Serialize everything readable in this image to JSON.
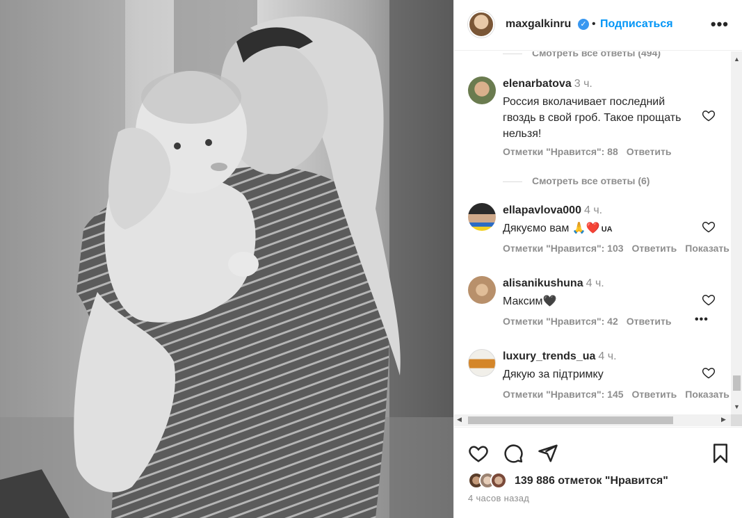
{
  "header": {
    "username": "maxgalkinru",
    "verified_icon": "verified-badge-icon",
    "separator": "•",
    "follow_label": "Подписаться",
    "more_label": "•••"
  },
  "comments": {
    "view_replies_top": "Смотреть все ответы (494)",
    "view_replies_mid": "Смотреть все ответы (6)",
    "items": [
      {
        "username": "elenarbatova",
        "time": "3 ч.",
        "text": "Россия вколачивает последний гвоздь в свой гроб. Такое прощать нельзя!",
        "likes": "Отметки \"Нравится\": 88",
        "reply": "Ответить",
        "extra": ""
      },
      {
        "username": "ellapavlova000",
        "time": "4 ч.",
        "text": "Дякуємо вам 🙏❤️",
        "text_badge": "UA",
        "likes": "Отметки \"Нравится\": 103",
        "reply": "Ответить",
        "extra": "Показать перевод"
      },
      {
        "username": "alisanikushuna",
        "time": "4 ч.",
        "text": "Максим🖤",
        "likes": "Отметки \"Нравится\": 42",
        "reply": "Ответить",
        "extra": "•••"
      },
      {
        "username": "luxury_trends_ua",
        "time": "4 ч.",
        "text": "Дякую за підтримку",
        "likes": "Отметки \"Нравится\": 145",
        "reply": "Ответить",
        "extra": "Показать перевод"
      }
    ]
  },
  "actions": {
    "icons": [
      "heart-icon",
      "comment-icon",
      "share-icon",
      "bookmark-icon"
    ],
    "likes_text": "139 886 отметок \"Нравится\"",
    "posted_ago": "4 часов назад"
  },
  "colors": {
    "accent": "#0095f6",
    "muted": "#8e8e8e",
    "text": "#262626"
  }
}
